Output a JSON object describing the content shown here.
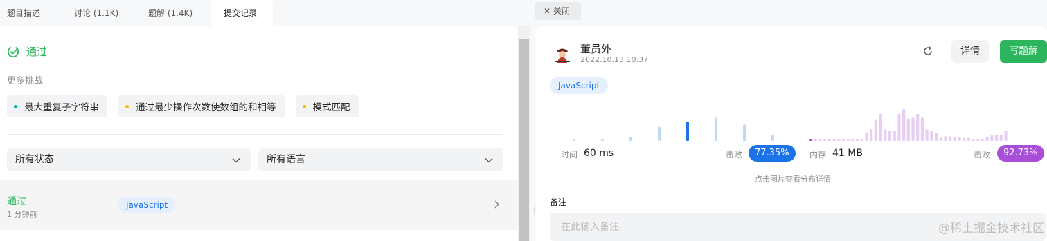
{
  "tabs": [
    {
      "label": "题目描述"
    },
    {
      "label": "讨论 (1.1K)"
    },
    {
      "label": "题解 (1.4K)"
    },
    {
      "label": "提交记录"
    }
  ],
  "close_tab": {
    "label": "✕ 关闭"
  },
  "result": {
    "status": "通过"
  },
  "more": {
    "label": "更多挑战",
    "items": [
      {
        "text": "最大重复子字符串",
        "dot_color": "#00af9b"
      },
      {
        "text": "通过最少操作次数使数组的和相等",
        "dot_color": "#ffb800"
      },
      {
        "text": "模式匹配",
        "dot_color": "#ffb800"
      }
    ]
  },
  "filters": {
    "status": "所有状态",
    "language": "所有语言"
  },
  "submission": {
    "status": "通过",
    "time": "1 分钟前",
    "language": "JavaScript"
  },
  "user": {
    "name": "董员外",
    "date": "2022.10.13 10:37"
  },
  "actions": {
    "detail": "详情",
    "write": "写题解"
  },
  "language": "JavaScript",
  "runtime": {
    "label": "时间",
    "value": "60 ms",
    "beat_label": "击败",
    "beat": "77.35%"
  },
  "memory": {
    "label": "内存",
    "value": "41 MB",
    "beat_label": "击败",
    "beat": "92.73%"
  },
  "hint": "点击图片查看分布详情",
  "note": {
    "label": "备注",
    "placeholder": "在此输入备注"
  },
  "watermark": "@稀土掘金技术社区",
  "colors": {
    "green": "#2db55d",
    "blue": "#1a73e8",
    "purple": "#a94ed8"
  },
  "chart_data": [
    {
      "type": "bar",
      "series": [
        {
          "values": [
            0.04,
            0.04,
            0.1,
            0.36,
            0.5,
            0.6,
            0.42,
            0.16
          ]
        }
      ],
      "highlight_index": 4
    },
    {
      "type": "bar",
      "series": [
        {
          "values": [
            0.05,
            0.05,
            0.05,
            0.05,
            0.05,
            0.05,
            0.05,
            0.05,
            0.05,
            0.05,
            0.05,
            0.05,
            0.2,
            0.3,
            0.54,
            0.7,
            0.3,
            0.26,
            0.26,
            0.7,
            0.82,
            0.56,
            0.6,
            0.7,
            0.6,
            0.3,
            0.26,
            0.2,
            0.08,
            0.12,
            0.12,
            0.1,
            0.1,
            0.08,
            0.08,
            0.05,
            0.05,
            0.05,
            0.1,
            0.14,
            0.16,
            0.16,
            0.26
          ]
        }
      ],
      "highlight_index": 0
    }
  ]
}
